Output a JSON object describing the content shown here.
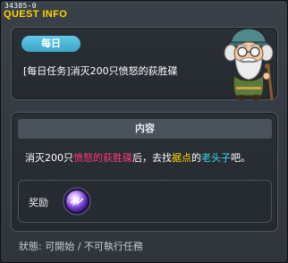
{
  "window": {
    "quest_id": "34385-0",
    "title": "QUEST INFO"
  },
  "quest": {
    "tag": "每日",
    "title": "[每日任务]消灭200只愤怒的荻胜碟"
  },
  "content": {
    "header": "内容",
    "desc_part1": "消灭200只",
    "desc_red": "愤怒的荻胜碟",
    "desc_part2": "后，去找",
    "desc_yellow": "据点",
    "desc_part3": "的",
    "desc_cyan": "老头子",
    "desc_part4": "吧。"
  },
  "reward": {
    "label": "奖励",
    "icon": "purple-orb-icon"
  },
  "status": {
    "text": "狀態:  可開始  / 不可執行任務"
  },
  "colors": {
    "title_yellow": "#ffd400",
    "tag_blue": "#4ab8d8",
    "highlight_red": "#ff3a7a",
    "highlight_yellow": "#ffd400",
    "highlight_cyan": "#38d8f0"
  }
}
